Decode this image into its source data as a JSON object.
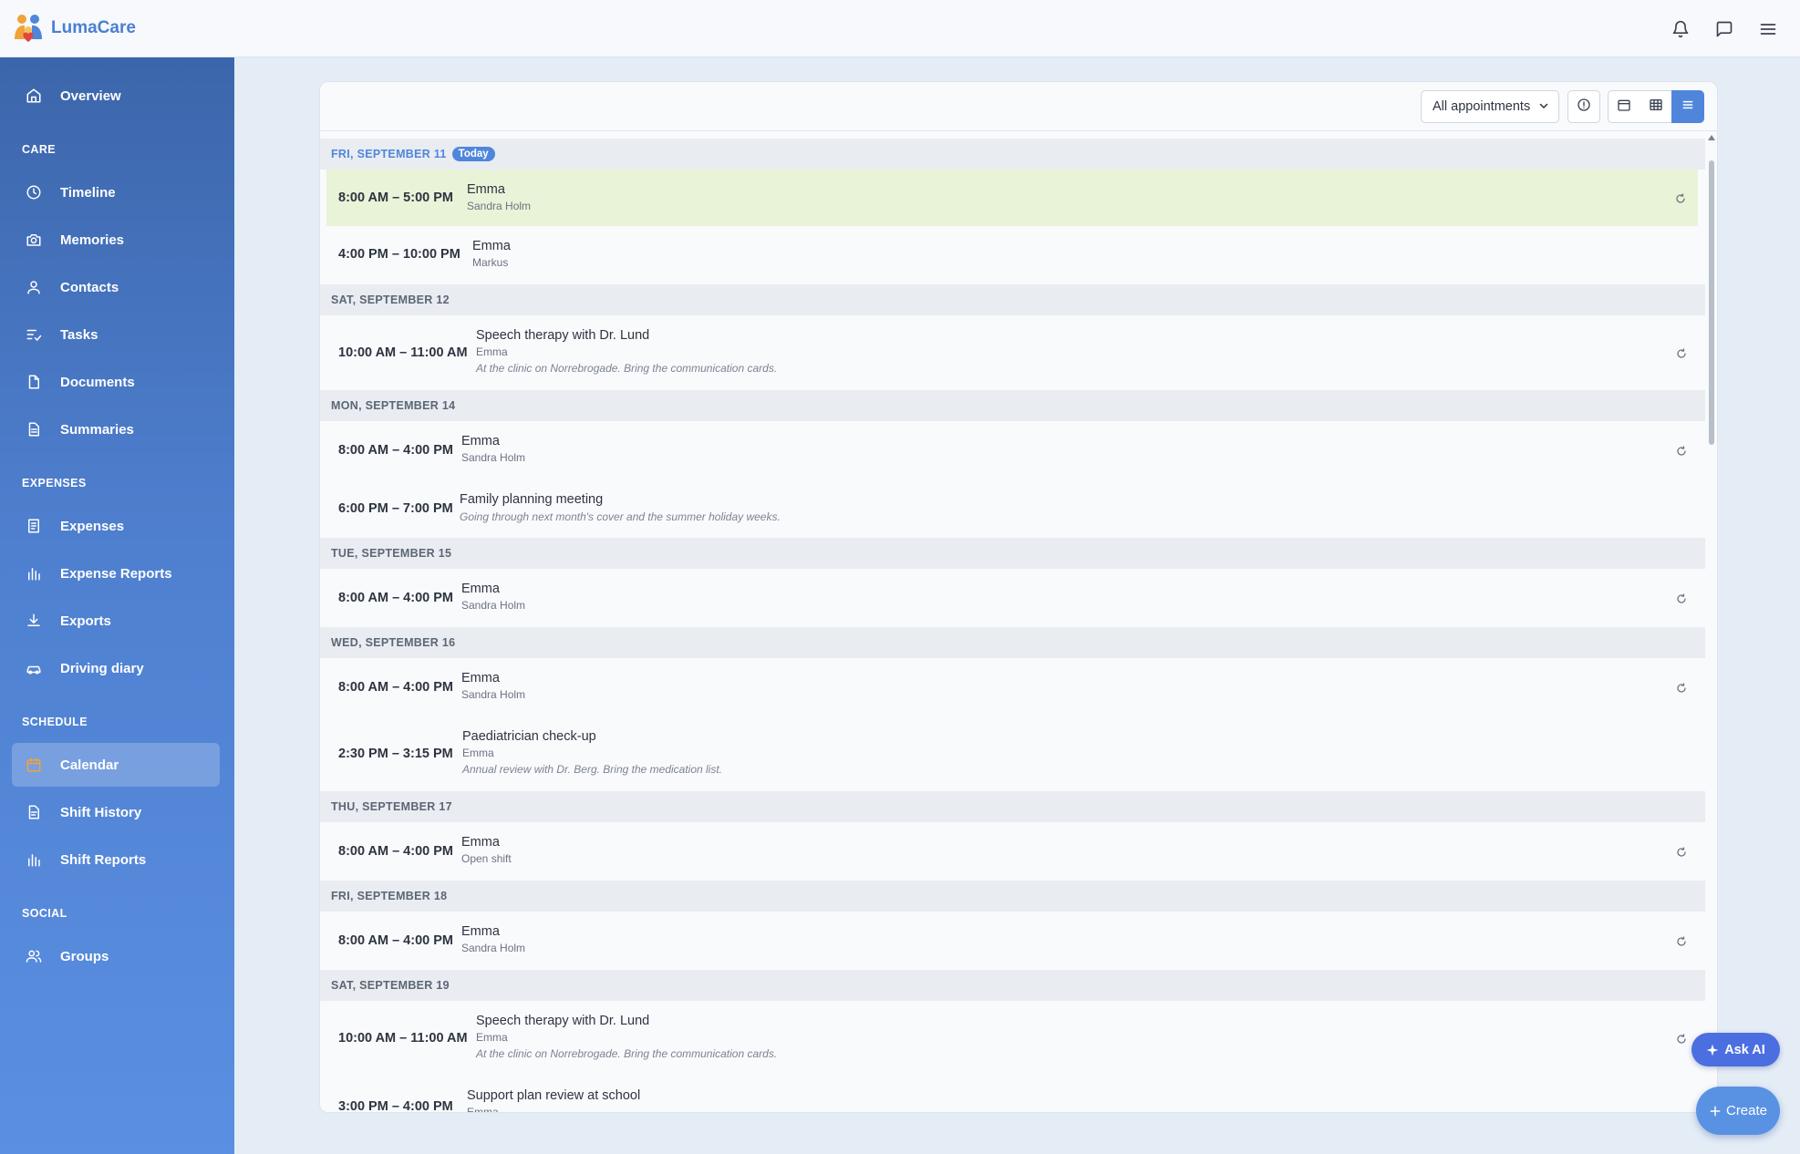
{
  "app": {
    "name": "LumaCare"
  },
  "header": {
    "icons": [
      "bell-icon",
      "chat-icon",
      "menu-icon"
    ]
  },
  "sidebar": {
    "sections": {
      "care": "CARE",
      "expenses": "EXPENSES",
      "schedule": "SCHEDULE",
      "social": "SOCIAL"
    },
    "items": [
      {
        "label": "Overview",
        "icon": "home-icon"
      },
      {
        "label": "Timeline",
        "icon": "clock-icon"
      },
      {
        "label": "Memories",
        "icon": "camera-icon"
      },
      {
        "label": "Contacts",
        "icon": "user-icon"
      },
      {
        "label": "Tasks",
        "icon": "checklist-icon"
      },
      {
        "label": "Documents",
        "icon": "document-icon"
      },
      {
        "label": "Summaries",
        "icon": "summary-icon"
      },
      {
        "label": "Expenses",
        "icon": "receipt-icon"
      },
      {
        "label": "Expense Reports",
        "icon": "bar-chart-icon"
      },
      {
        "label": "Exports",
        "icon": "download-icon"
      },
      {
        "label": "Driving diary",
        "icon": "car-icon"
      },
      {
        "label": "Calendar",
        "icon": "calendar-icon",
        "active": true
      },
      {
        "label": "Shift History",
        "icon": "history-icon"
      },
      {
        "label": "Shift Reports",
        "icon": "bar-chart-icon"
      },
      {
        "label": "Groups",
        "icon": "group-icon"
      }
    ]
  },
  "toolbar": {
    "filter_value": "All appointments"
  },
  "colors": {
    "accent": "#4f86dc",
    "highlight": "#e9f3d8",
    "sidebar_top": "#3c66ab",
    "sidebar_bottom": "#5a8fe1"
  },
  "days": [
    {
      "label": "FRI, SEPTEMBER 11",
      "badge": "Today"
    },
    {
      "label": "SAT, SEPTEMBER 12"
    },
    {
      "label": "MON, SEPTEMBER 14"
    },
    {
      "label": "TUE, SEPTEMBER 15"
    },
    {
      "label": "WED, SEPTEMBER 16"
    },
    {
      "label": "THU, SEPTEMBER 17"
    },
    {
      "label": "FRI, SEPTEMBER 18"
    },
    {
      "label": "SAT, SEPTEMBER 19"
    }
  ],
  "events": [
    {
      "time": "8:00 AM – 5:00 PM",
      "title": "Emma",
      "sub": "Sandra Holm"
    },
    {
      "time": "4:00 PM – 10:00 PM",
      "title": "Emma",
      "sub": "Markus"
    },
    {
      "time": "10:00 AM – 11:00 AM",
      "title": "Speech therapy with Dr. Lund",
      "sub": "Emma",
      "note": "At the clinic on Norrebrogade. Bring the communication cards."
    },
    {
      "time": "8:00 AM – 4:00 PM",
      "title": "Emma",
      "sub": "Sandra Holm"
    },
    {
      "time": "6:00 PM – 7:00 PM",
      "title": "Family planning meeting",
      "note": "Going through next month's cover and the summer holiday weeks."
    },
    {
      "time": "8:00 AM – 4:00 PM",
      "title": "Emma",
      "sub": "Sandra Holm"
    },
    {
      "time": "8:00 AM – 4:00 PM",
      "title": "Emma",
      "sub": "Sandra Holm"
    },
    {
      "time": "2:30 PM – 3:15 PM",
      "title": "Paediatrician check-up",
      "sub": "Emma",
      "note": "Annual review with Dr. Berg. Bring the medication list."
    },
    {
      "time": "8:00 AM – 4:00 PM",
      "title": "Emma",
      "sub": "Open shift"
    },
    {
      "time": "8:00 AM – 4:00 PM",
      "title": "Emma",
      "sub": "Sandra Holm"
    },
    {
      "time": "10:00 AM – 11:00 AM",
      "title": "Speech therapy with Dr. Lund",
      "sub": "Emma",
      "note": "At the clinic on Norrebrogade. Bring the communication cards."
    },
    {
      "time": "3:00 PM – 4:00 PM",
      "title": "Support plan review at school",
      "sub": "Emma"
    }
  ],
  "floating": {
    "ask_ai": "Ask AI",
    "create": "Create"
  }
}
